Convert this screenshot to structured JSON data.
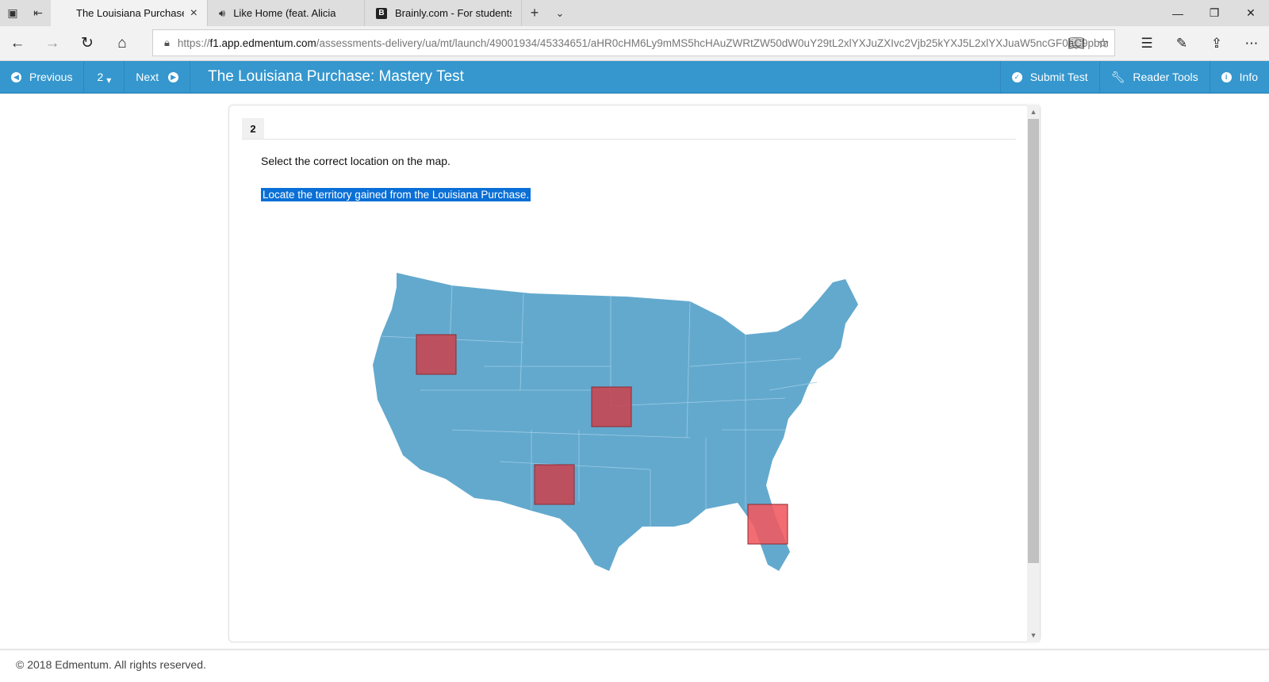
{
  "browser": {
    "tabs": [
      {
        "title": "The Louisiana Purchase:",
        "active": true
      },
      {
        "title": "Like Home (feat. Alicia",
        "active": false
      },
      {
        "title": "Brainly.com - For students.",
        "active": false
      }
    ],
    "url_prefix": "https://",
    "url_host": "f1.app.edmentum.com",
    "url_rest": "/assessments-delivery/ua/mt/launch/49001934/45334651/aHR0cHM6Ly9mMS5hcHAuZWRtZW50dW0uY29tL2xlYXJuZXIvc2Vjb25kYXJ5L2xlYXJuaW5ncGF0aC9pbm"
  },
  "toolbar": {
    "previous_label": "Previous",
    "question_number": "2",
    "next_label": "Next",
    "test_title": "The Louisiana Purchase: Mastery Test",
    "submit_label": "Submit Test",
    "reader_tools_label": "Reader Tools",
    "info_label": "Info"
  },
  "question": {
    "number": "2",
    "instruction": "Select the correct location on the map.",
    "prompt": "Locate the territory gained from the Louisiana Purchase.",
    "map_fill_color": "#63a9ce",
    "hotspot_color": "#c9434e",
    "hotspot_hover_color": "#f0585e",
    "hotspots": [
      {
        "name": "northwest",
        "highlighted": false
      },
      {
        "name": "great-plains",
        "highlighted": false
      },
      {
        "name": "southwest",
        "highlighted": false
      },
      {
        "name": "florida",
        "highlighted": true
      }
    ]
  },
  "footer": {
    "copyright": "© 2018 Edmentum. All rights reserved."
  }
}
